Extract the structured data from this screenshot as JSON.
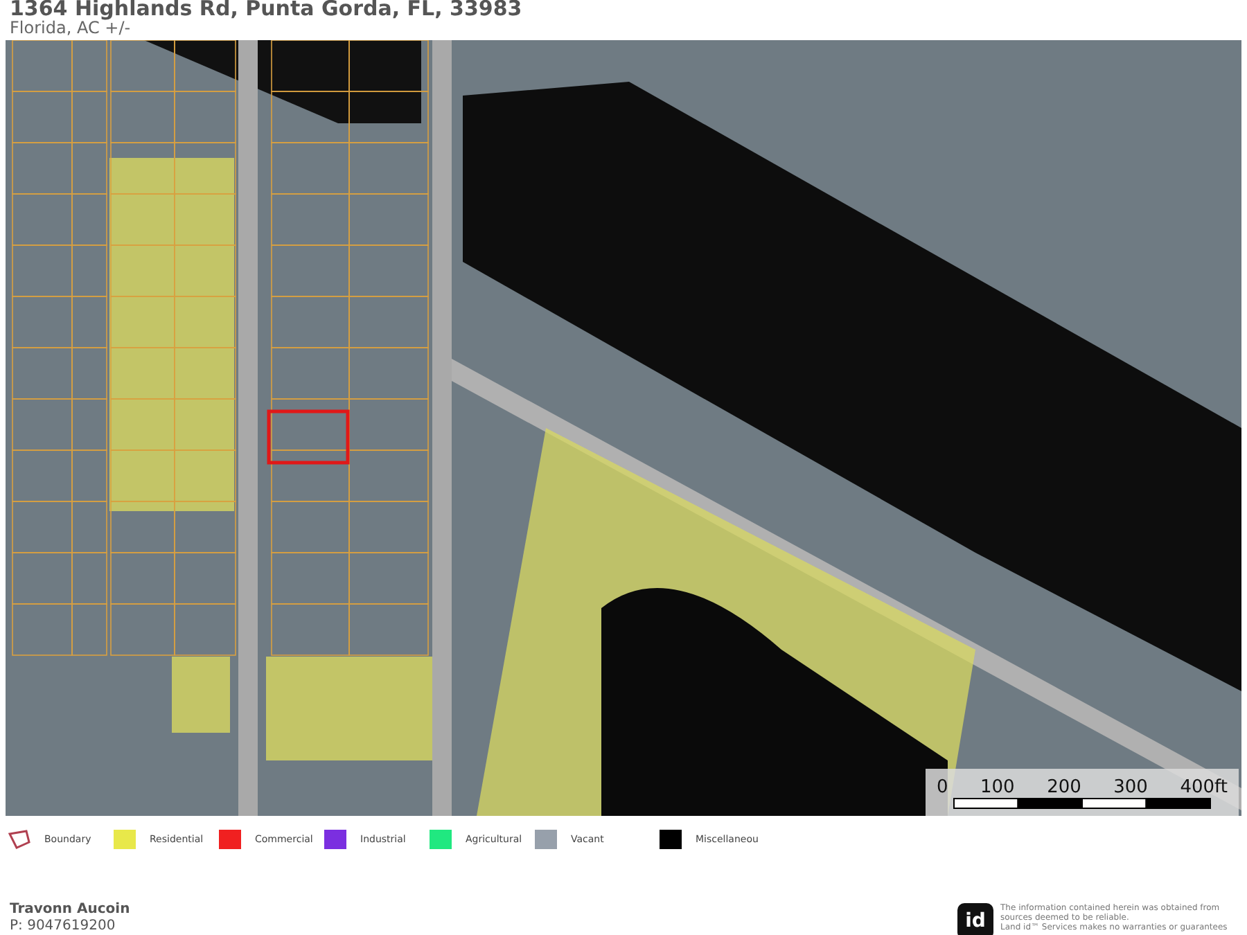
{
  "header": {
    "title": "1364 Highlands Rd, Punta Gorda, FL, 33983",
    "subtitle": "Florida,  AC +/-"
  },
  "map": {
    "scale_labels": [
      "0",
      "100",
      "200",
      "300",
      "400ft"
    ]
  },
  "legend": [
    {
      "kind": "outline",
      "label": "Boundary",
      "color": "#b04050"
    },
    {
      "kind": "swatch",
      "label": "Residential",
      "color": "#e8e84a"
    },
    {
      "kind": "swatch",
      "label": "Commercial",
      "color": "#f02020"
    },
    {
      "kind": "swatch",
      "label": "Industrial",
      "color": "#7b2fe0"
    },
    {
      "kind": "swatch",
      "label": "Agricultural",
      "color": "#20e880"
    },
    {
      "kind": "swatch",
      "label": "Vacant",
      "color": "#97a0ab"
    },
    {
      "kind": "swatch",
      "label": "Miscellaneou",
      "color": "#000000"
    }
  ],
  "footer": {
    "agent": "Travonn Aucoin",
    "phone": "P: 9047619200",
    "logo": "id",
    "disclaimer": [
      "The information contained herein was obtained from",
      "sources deemed to be reliable.",
      "Land id™ Services makes no warranties or guarantees"
    ]
  }
}
